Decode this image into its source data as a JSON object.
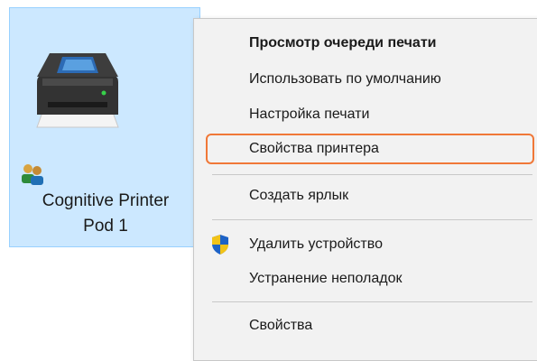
{
  "device": {
    "name_line1": "Cognitive Printer",
    "name_line2": "Pod 1",
    "icon": "printer-icon",
    "shared_icon": "shared-users-icon"
  },
  "context_menu": {
    "items": [
      {
        "label": "Просмотр очереди печати",
        "bold": true
      },
      {
        "label": "Использовать по умолчанию"
      },
      {
        "label": "Настройка печати"
      },
      {
        "label": "Свойства принтера",
        "highlighted": true
      },
      {
        "label": "Создать ярлык"
      },
      {
        "label": "Удалить устройство",
        "icon": "uac-shield-icon"
      },
      {
        "label": "Устранение неполадок"
      },
      {
        "label": "Свойства"
      }
    ]
  },
  "colors": {
    "selection_bg": "#cce8ff",
    "highlight_border": "#f07838",
    "menu_bg": "#f2f2f2"
  }
}
